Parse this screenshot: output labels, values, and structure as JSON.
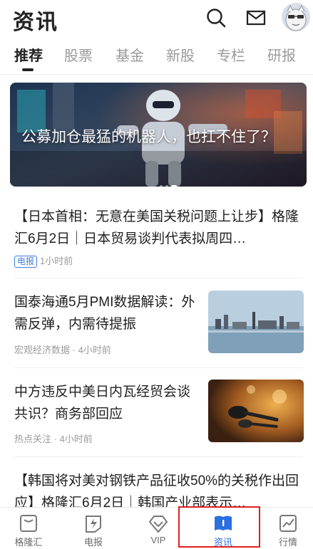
{
  "header": {
    "title": "资讯",
    "icons": [
      "search-icon",
      "mail-icon",
      "avatar"
    ]
  },
  "tabs": [
    {
      "label": "推荐",
      "active": true
    },
    {
      "label": "股票"
    },
    {
      "label": "基金"
    },
    {
      "label": "新股"
    },
    {
      "label": "专栏"
    },
    {
      "label": "研报"
    }
  ],
  "banner": {
    "title": "公募加仓最猛的机器人，也扛不住了？"
  },
  "news": [
    {
      "text": "【日本首相：无意在美国关税问题上让步】格隆汇6月2日｜日本贸易谈判代表拟周四…",
      "badge": "电报",
      "meta": "1小时前"
    },
    {
      "text": "国泰海通5月PMI数据解读：外需反弹，内需待提振",
      "source": "宏观经济数据",
      "meta": "4小时前"
    },
    {
      "text": "中方违反中美日内瓦经贸会谈共识？商务部回应",
      "source": "热点关注",
      "meta": "4小时前"
    },
    {
      "text": "【韩国将对美对钢铁产品征收50%的关税作出回应】格隆汇6月2日｜韩国产业部表示…"
    }
  ],
  "bottom_nav": [
    {
      "label": "格隆汇",
      "icon": "gelonghui-icon"
    },
    {
      "label": "电报",
      "icon": "lightning-icon"
    },
    {
      "label": "VIP",
      "icon": "vip-icon"
    },
    {
      "label": "资讯",
      "icon": "news-book-icon",
      "active": true
    },
    {
      "label": "行情",
      "icon": "chart-icon"
    }
  ],
  "colors": {
    "accent": "#2b6fe0",
    "highlight": "#e02020",
    "badge": "#3d7ddb"
  }
}
